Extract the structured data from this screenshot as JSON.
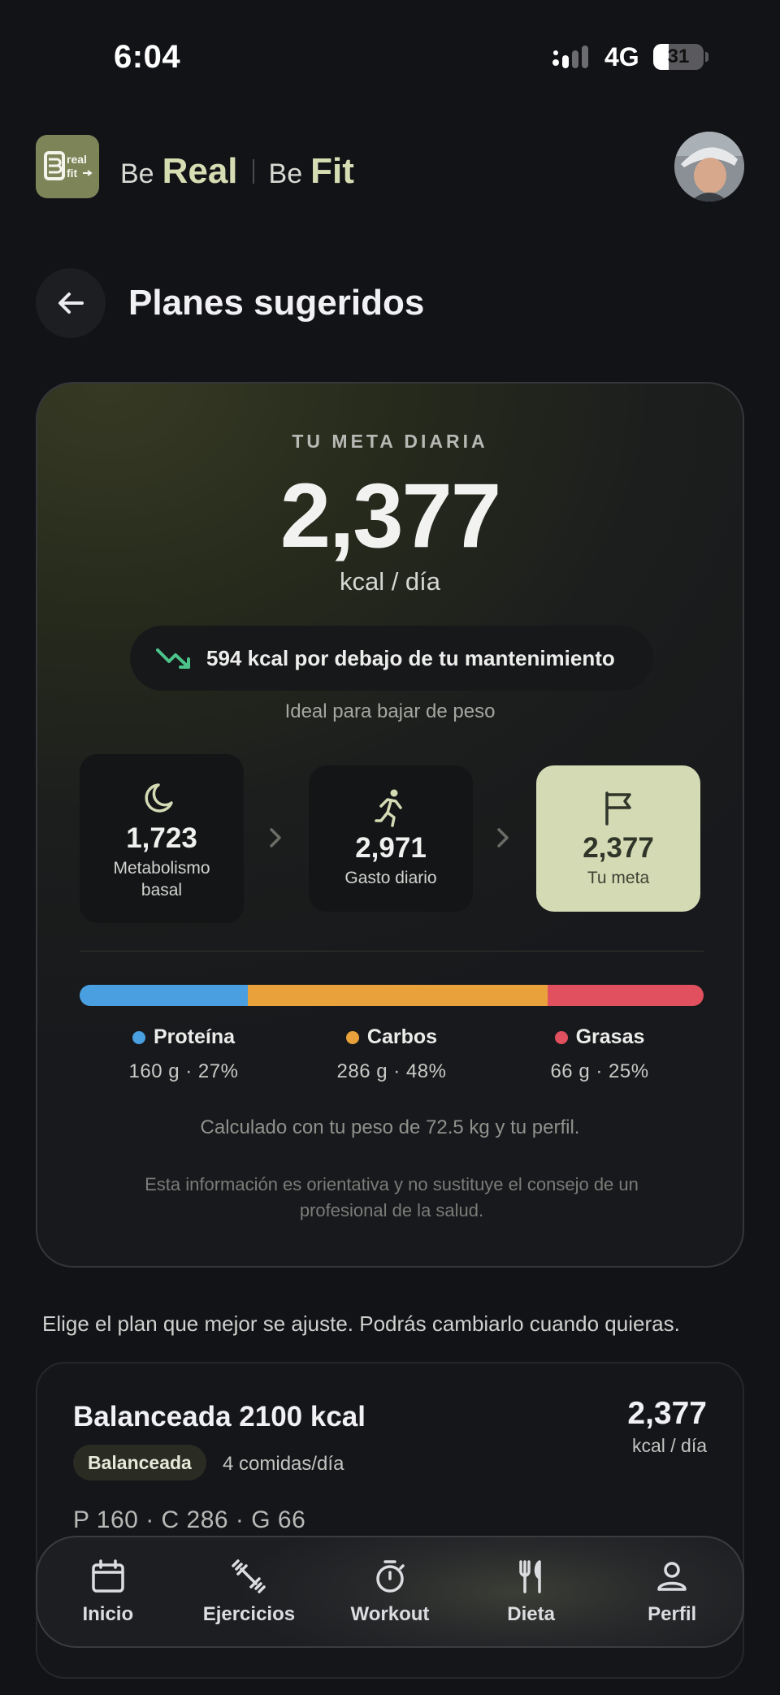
{
  "status_bar": {
    "time": "6:04",
    "network": "4G",
    "battery": "31",
    "battery_level": 0.31
  },
  "header": {
    "logo_top": "real",
    "logo_bottom": "fit",
    "brand": {
      "be1": "Be",
      "real": "Real",
      "be2": "Be",
      "fit": "Fit"
    }
  },
  "page": {
    "title": "Planes sugeridos",
    "back_icon": "arrow-left-icon"
  },
  "goal": {
    "label": "TU META DIARIA",
    "value": "2,377",
    "unit": "kcal / día",
    "deficit_text": "594 kcal por debajo de tu mantenimiento",
    "deficit_icon": "trend-down-icon",
    "deficit_sub": "Ideal para bajar de peso",
    "flow": [
      {
        "icon": "moon-icon",
        "value": "1,723",
        "label": "Metabolismo basal"
      },
      {
        "icon": "runner-icon",
        "value": "2,971",
        "label": "Gasto diario"
      },
      {
        "icon": "flag-icon",
        "value": "2,377",
        "label": "Tu meta"
      }
    ],
    "macros": [
      {
        "name": "Proteína",
        "detail": "160 g · 27%",
        "percent": 27,
        "color": "#4A9FE0"
      },
      {
        "name": "Carbos",
        "detail": "286 g · 48%",
        "percent": 48,
        "color": "#E9A23B"
      },
      {
        "name": "Grasas",
        "detail": "66 g · 25%",
        "percent": 25,
        "color": "#E0505E"
      }
    ],
    "calc_note": "Calculado con tu peso de 72.5 kg y tu perfil.",
    "disclaimer": "Esta información es orientativa y no sustituye el consejo de un profesional de la salud."
  },
  "choose_text": "Elige el plan que mejor se ajuste. Podrás cambiarlo cuando quieras.",
  "plan": {
    "name": "Balanceada 2100 kcal",
    "tag": "Balanceada",
    "meals": "4 comidas/día",
    "kcal": "2,377",
    "unit": "kcal / día",
    "macros": "P 160 · C 286 · G 66"
  },
  "nav": [
    {
      "label": "Inicio",
      "icon": "calendar-icon"
    },
    {
      "label": "Ejercicios",
      "icon": "dumbbell-icon"
    },
    {
      "label": "Workout",
      "icon": "stopwatch-icon"
    },
    {
      "label": "Dieta",
      "icon": "fork-knife-icon"
    },
    {
      "label": "Perfil",
      "icon": "user-icon"
    }
  ],
  "colors": {
    "accent": "#D4DAB4",
    "background": "#121317",
    "trend": "#4CC38A"
  }
}
